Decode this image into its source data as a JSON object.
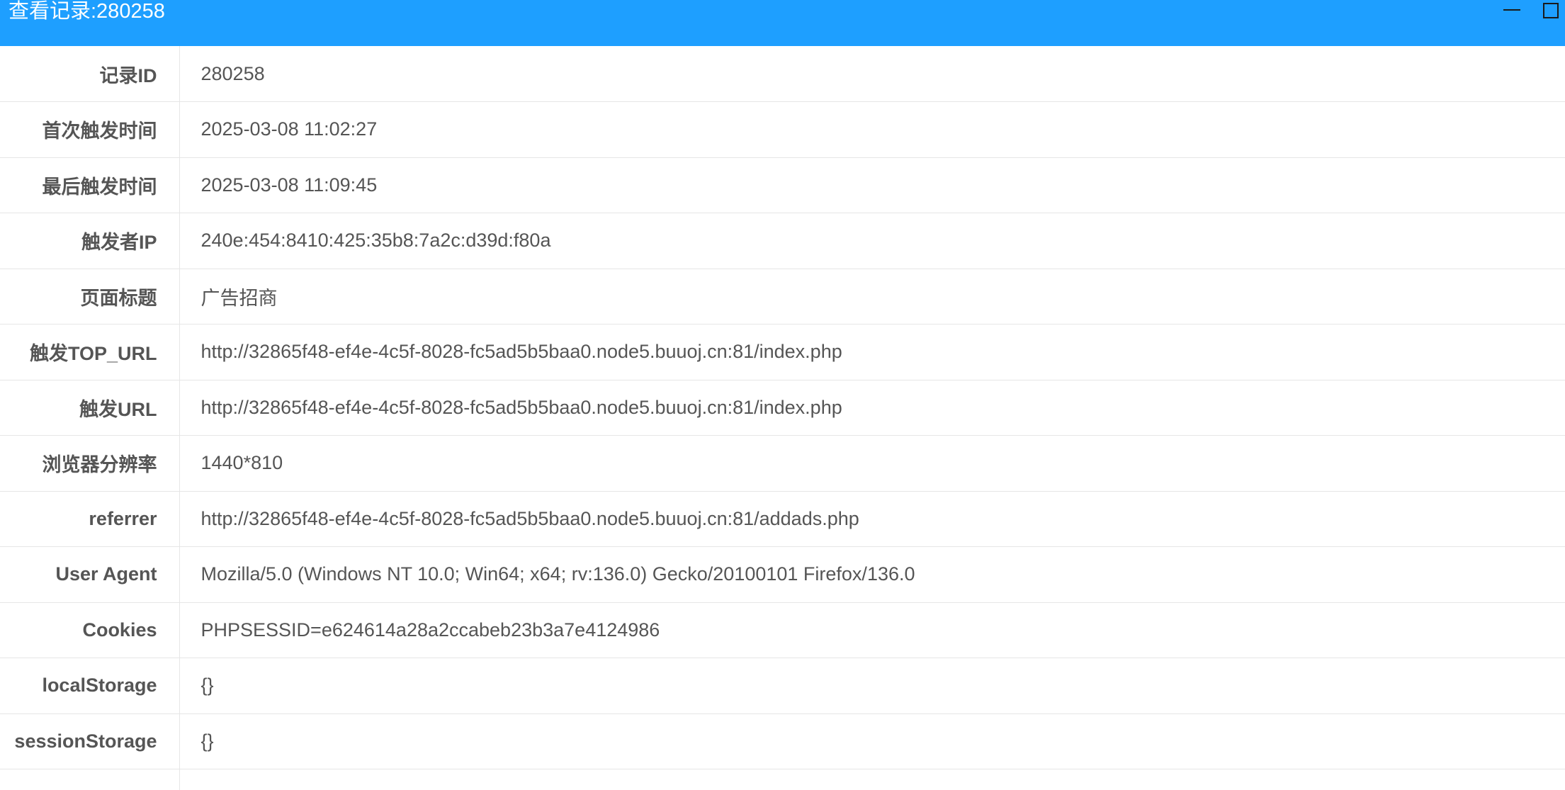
{
  "window": {
    "title": "查看记录:280258"
  },
  "fields": [
    {
      "label": "记录ID",
      "value": "280258"
    },
    {
      "label": "首次触发时间",
      "value": "2025-03-08 11:02:27"
    },
    {
      "label": "最后触发时间",
      "value": "2025-03-08 11:09:45"
    },
    {
      "label": "触发者IP",
      "value": "240e:454:8410:425:35b8:7a2c:d39d:f80a"
    },
    {
      "label": "页面标题",
      "value": "广告招商"
    },
    {
      "label": "触发TOP_URL",
      "value": "http://32865f48-ef4e-4c5f-8028-fc5ad5b5baa0.node5.buuoj.cn:81/index.php"
    },
    {
      "label": "触发URL",
      "value": "http://32865f48-ef4e-4c5f-8028-fc5ad5b5baa0.node5.buuoj.cn:81/index.php"
    },
    {
      "label": "浏览器分辨率",
      "value": "1440*810"
    },
    {
      "label": "referrer",
      "value": "http://32865f48-ef4e-4c5f-8028-fc5ad5b5baa0.node5.buuoj.cn:81/addads.php"
    },
    {
      "label": "User Agent",
      "value": "Mozilla/5.0 (Windows NT 10.0; Win64; x64; rv:136.0) Gecko/20100101 Firefox/136.0"
    },
    {
      "label": "Cookies",
      "value": "PHPSESSID=e624614a28a2ccabeb23b3a7e4124986"
    },
    {
      "label": "localStorage",
      "value": "{}"
    },
    {
      "label": "sessionStorage",
      "value": "{}"
    }
  ],
  "colors": {
    "titlebar": "#1e9fff",
    "label_text": "#555555",
    "value_text": "#555555",
    "border": "#e6e6e6",
    "code_block": "#263238"
  },
  "icons": {
    "minimize": "minimize-icon",
    "maximize": "maximize-icon"
  }
}
